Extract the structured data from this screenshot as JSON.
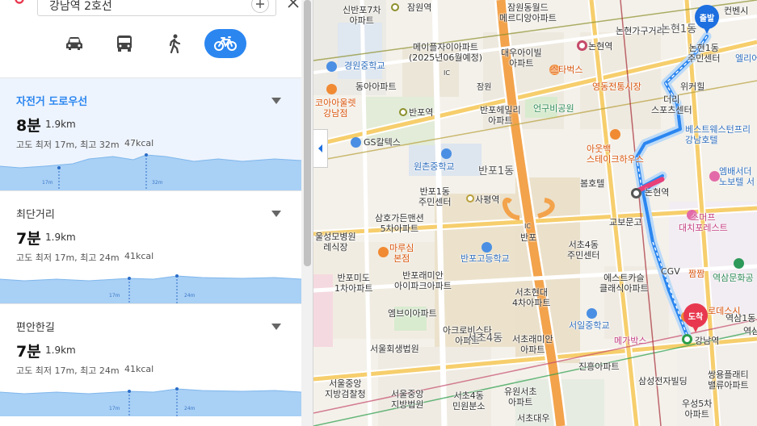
{
  "search": {
    "query": "강남역 2호선"
  },
  "modes": [
    {
      "name": "car",
      "active": false
    },
    {
      "name": "bus",
      "active": false
    },
    {
      "name": "walk",
      "active": false
    },
    {
      "name": "bicycle",
      "active": true
    }
  ],
  "routes": [
    {
      "title": "자전거 도로우선",
      "time": "8분",
      "distance": "1.9km",
      "elevation": "고도 최저 17m, 최고 32m",
      "kcal": "47kcal",
      "min_label": "17m",
      "max_label": "32m"
    },
    {
      "title": "최단거리",
      "time": "7분",
      "distance": "1.9km",
      "elevation": "고도 최저 17m, 최고 24m",
      "kcal": "41kcal",
      "min_label": "17m",
      "max_label": "24m"
    },
    {
      "title": "편안한길",
      "time": "7분",
      "distance": "1.9km",
      "elevation": "고도 최저 17m, 최고 24m",
      "kcal": "41kcal",
      "min_label": "17m",
      "max_label": "24m"
    }
  ],
  "map": {
    "start_marker": "출발",
    "end_marker": "도착",
    "labels": {
      "l1": "신반포7차\n아파트",
      "l2": "잠원역",
      "l3": "잠원동월드\n메르디앙아파트",
      "l4": "컨벤시",
      "l5": "메이플자이아파트\n(2025년06월예정)",
      "l6": "논현역",
      "l7": "논현가구거리",
      "l8": "논현1동",
      "l9": "경원중학교",
      "l10": "대우아이빌\n아파트",
      "l11": "논현1동\n주민센터",
      "l12": "엘리어",
      "l13": "스타벅스",
      "l14": "영동전통시장",
      "l15": "동아아파트",
      "l16": "잠원",
      "l17": "반포헤밀리\n아파트",
      "l18": "언구비공원",
      "l19": "위커힐",
      "l20": "코아아울렛\n강남점",
      "l21": "반포역",
      "l22": "더리\n스포츠센터",
      "l23": "GS칼텍스",
      "l24": "베스트웨스턴프리\n강남호텔",
      "l25": "아웃백\n스테이크하우스",
      "l26": "원촌중학교",
      "l27": "반포1동",
      "l28": "봄호텔",
      "l29": "엠배서더\n노보텔 서",
      "l30": "반포1동\n주민센터",
      "l31": "사평역",
      "l32": "논현역",
      "l33": "삼호가든맨션\n5차아파트",
      "l34": "반포",
      "l35": "교보문고",
      "l36": "스머프\n대치포레스트",
      "l37": "울성모병원\n레식장",
      "l38": "마루심\n본점",
      "l39": "서초4동\n주민센터",
      "l40": "반포고등학교",
      "l41": "반포미도\n1차아파트",
      "l42": "반포래미안\n아이파크아파트",
      "l43": "서초현대\n4차아파트",
      "l44": "에스트카슬\n클래식아파트",
      "l45": "CGV",
      "l46": "짬짬",
      "l47": "역삼문화공",
      "l48": "엠브이아파트",
      "l49": "서일중학교",
      "l50": "로데스시",
      "l51": "역삼1동",
      "l52": "아크로비스타\n아파트",
      "l53": "서초4동",
      "l54": "메가박스",
      "l55": "강남역",
      "l56": "역삼",
      "l57": "서울회생법원",
      "l58": "서초래미안\n아파트",
      "l59": "진흥아파트",
      "l60": "삼성전자빌딩",
      "l61": "쌍용플래티\n밸류아파트",
      "l62": "서울중앙\n지방검찰청",
      "l63": "서울중앙\n지방법원",
      "l64": "서초4동\n민원분소",
      "l65": "유원서초\n아파트",
      "l66": "우성5차\n아파트",
      "l67": "서초대우",
      "l68": "IC",
      "l69": "IC"
    }
  },
  "colors": {
    "accent": "#2b86f0",
    "route": "#2b86f0",
    "end_marker": "#e8384f",
    "start_marker": "#1e6fe0"
  }
}
